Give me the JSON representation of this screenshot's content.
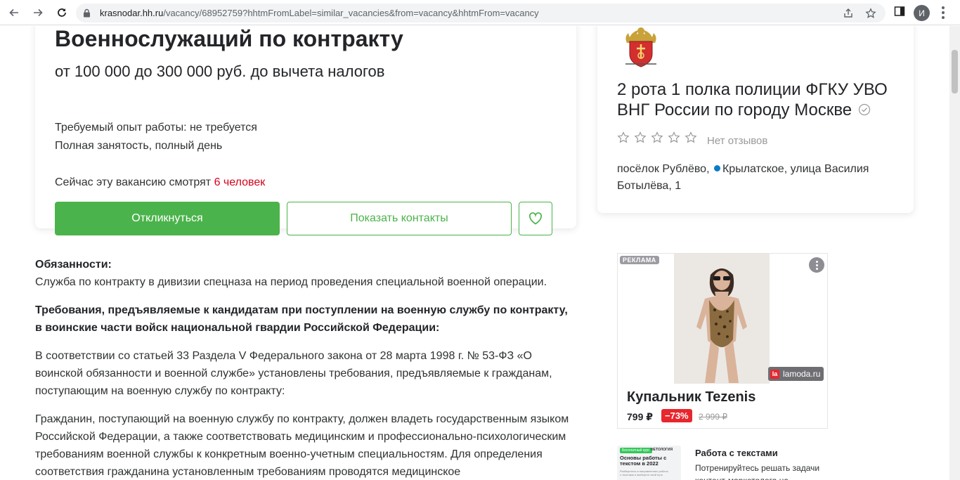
{
  "browser": {
    "url_host": "krasnodar.hh.ru",
    "url_path": "/vacancy/68952759?hhtmFromLabel=similar_vacancies&from=vacancy&hhtmFrom=vacancy",
    "profile_initial": "И"
  },
  "vacancy": {
    "title": "Военнослужащий по контракту",
    "salary": "от 100 000 до 300 000 руб. до вычета налогов",
    "experience": "Требуемый опыт работы: не требуется",
    "employment": "Полная занятость, полный день",
    "watching_prefix": "Сейчас эту вакансию смотрят ",
    "watching_count": "6 человек",
    "respond_label": "Откликнуться",
    "contacts_label": "Показать контакты"
  },
  "employer": {
    "name": "2 рота 1 полка полиции ФГКУ УВО ВНГ России по городу Москве",
    "rating_stars": 0,
    "reviews": "Нет отзывов",
    "address_part1": "посёлок Рублёво,",
    "address_part2": "Крылатское, улица Василия Ботылёва, 1",
    "metro_color": "#0a7cc5"
  },
  "description": {
    "duties_heading": "Обязанности:",
    "duties_text": "Служба по контракту в дивизии спецназа на период проведения специальной военной операции.",
    "requirements_heading": "Требования, предъявляемые к кандидатам при поступлении на военную службу по контракту, в воинские части войск национальной гвардии Российской Федерации:",
    "paragraph1": "В соответствии со статьей 33 Раздела V Федерального закона от 28 марта 1998 г. № 53-ФЗ «О воинской обязанности и военной службе» установлены требования, предъявляемые к гражданам, поступающим на военную службу по контракту:",
    "paragraph2": "Гражданин, поступающий на военную службу по контракту, должен владеть государственным языком Российской Федерации, а также соответствовать медицинским и профессионально-психологическим требованиям военной службы к конкретным военно-учетным специальностям. Для определения соответствия гражданина установленным требованиям проводятся медицинское"
  },
  "ad": {
    "label": "РЕКЛАМА",
    "brand": "lamoda.ru",
    "brand_logo": "la",
    "title": "Купальник Tezenis",
    "price": "799 ₽",
    "discount": "−73%",
    "old_price": "2 999 ₽"
  },
  "course": {
    "thumb_tag": "Бесплатный курс",
    "thumb_brand": "НЕТОЛОГИЯ",
    "thumb_title": "Основы работы с текстом в 2022",
    "thumb_sub": "Разберитесь в направлениях работы с текстами и выберите свой путь",
    "title": "Работа с текстами",
    "text": "Потренируйтесь решать задачи контент-маркетолога на"
  },
  "colors": {
    "accent_green": "#4bb34b",
    "highlight_red": "#d6001c",
    "discount_red": "#e8262d"
  }
}
